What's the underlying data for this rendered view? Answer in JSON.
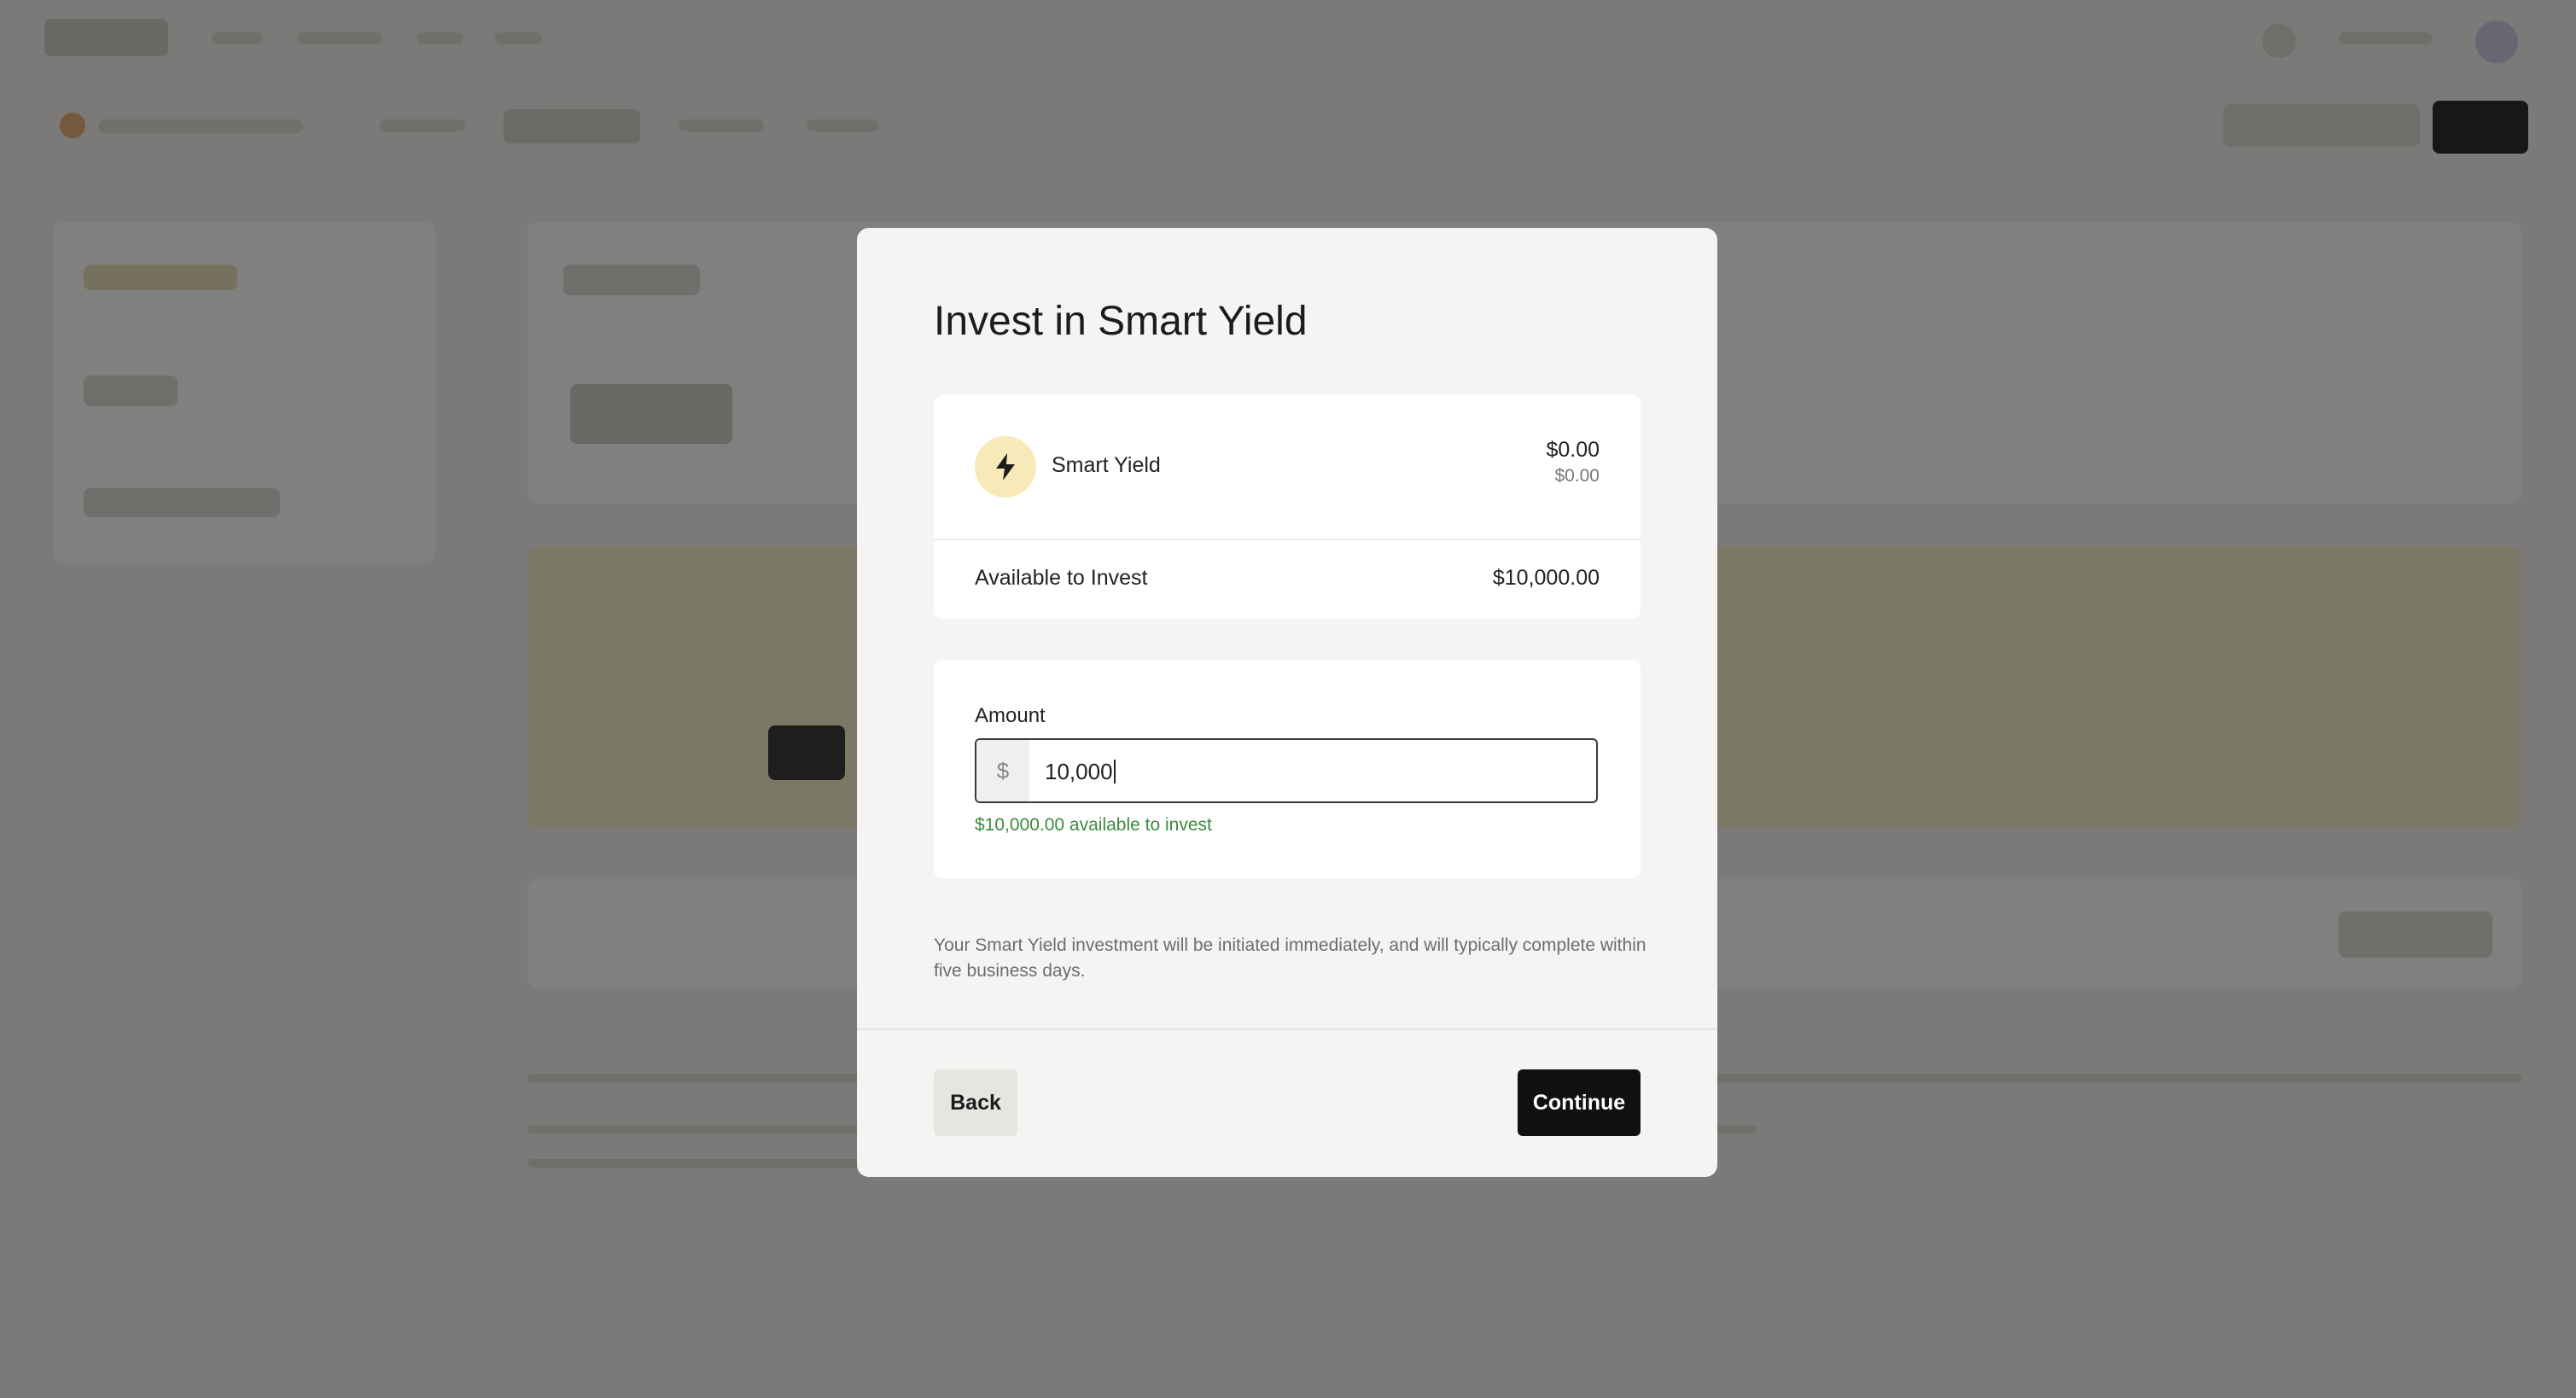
{
  "modal": {
    "title": "Invest in Smart Yield",
    "asset": {
      "name": "Smart Yield",
      "value": "$0.00",
      "sub_value": "$0.00",
      "icon": "lightning-bolt-icon"
    },
    "available": {
      "label": "Available to Invest",
      "value": "$10,000.00"
    },
    "amount": {
      "label": "Amount",
      "prefix": "$",
      "value": "10,000",
      "hint": "$10,000.00 available to invest"
    },
    "note": "Your Smart Yield investment will be initiated immediately, and will typically complete within five business days.",
    "buttons": {
      "back": "Back",
      "continue": "Continue"
    }
  },
  "colors": {
    "overlay": "#141414",
    "modal_bg": "#f5f4f2",
    "icon_bg": "#f8eab8",
    "hint_green": "#3c8a3f",
    "primary_button": "#111111"
  }
}
